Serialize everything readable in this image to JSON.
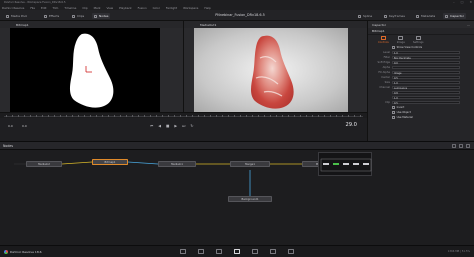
{
  "window": {
    "title": "DaVinci Resolve - Workspace Fusion_DRv18.6.5",
    "controls": [
      "–",
      "□",
      "✕"
    ]
  },
  "menubar": [
    "DaVinci Resolve",
    "File",
    "Edit",
    "Trim",
    "Timeline",
    "Clip",
    "Mark",
    "View",
    "Playback",
    "Fusion",
    "Color",
    "Fairlight",
    "Workspace",
    "Help"
  ],
  "toolbar": {
    "media_pool": "Media Pool",
    "effects": "Effects",
    "clips": "Clips",
    "nodes": "Nodes",
    "doc_title": "PNnebinar_Fusion_DRv18.6.5",
    "spline": "Spline",
    "keyframes": "Keyframes",
    "metadata": "Metadata",
    "inspector": "Inspector"
  },
  "viewers": {
    "left": "Bitmap1",
    "right": "MediaOut1"
  },
  "inspector": {
    "header": "Inspector",
    "node_name": "Bitmap1",
    "tabs": [
      "Controls",
      "Image",
      "Settings"
    ],
    "rows": [
      {
        "label": "",
        "type": "check",
        "value": "Show View Controls"
      },
      {
        "label": "Level",
        "type": "field",
        "value": "1.0"
      },
      {
        "label": "Filter",
        "type": "field",
        "value": "Box Decimate"
      },
      {
        "label": "Soft Edge",
        "type": "field",
        "value": "0.0"
      },
      {
        "label": "Alpha",
        "type": "field",
        "value": ""
      },
      {
        "label": "Fill Alpha",
        "type": "field",
        "value": "Image"
      },
      {
        "label": "Center",
        "type": "field",
        "value": "0.5"
      },
      {
        "label": "Size",
        "type": "field",
        "value": "1.0"
      },
      {
        "label": "Channel",
        "type": "field",
        "value": "Luminance"
      },
      {
        "label": "",
        "type": "field",
        "value": "0.8"
      },
      {
        "label": "",
        "type": "field",
        "value": "1.0"
      },
      {
        "label": "Clip",
        "type": "field",
        "value": "0.5"
      },
      {
        "label": "",
        "type": "check",
        "value": "Invert"
      },
      {
        "label": "",
        "type": "check",
        "value": "Use Object"
      },
      {
        "label": "",
        "type": "check",
        "value": "Use Material"
      }
    ]
  },
  "timeline": {
    "timecode_left": "0.0",
    "timecode_mid": "0.0",
    "timecode_right": "29.0",
    "play_controls": [
      "⏮",
      "◀",
      "■",
      "▶",
      "⏭",
      "↻"
    ]
  },
  "nodes_panel": {
    "title": "Nodes"
  },
  "nodes": [
    {
      "name": "MediaIn2"
    },
    {
      "name": "Bitmap1"
    },
    {
      "name": "MediaIn1"
    },
    {
      "name": "Merge1"
    },
    {
      "name": "MediaOut1"
    },
    {
      "name": "Background1"
    }
  ],
  "status": {
    "app_name": "DaVinci Resolve 18.6",
    "right_text": "1366 MB | 51.5%"
  },
  "colors": {
    "accent": "#e06a2a",
    "link_yellow": "#d8b82a",
    "link_blue": "#4aa8e0"
  }
}
